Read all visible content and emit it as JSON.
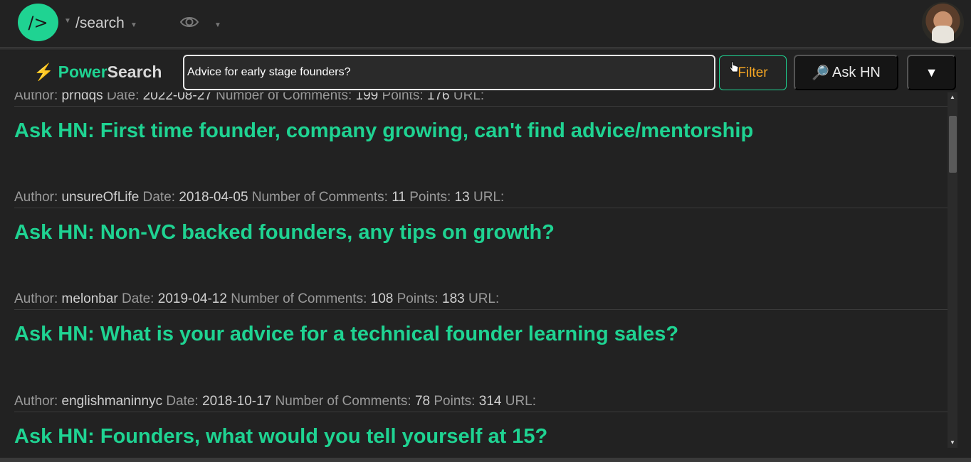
{
  "header": {
    "logo_text": "/>",
    "path": "/search",
    "visibility_icon": "eye-icon"
  },
  "search": {
    "brand_bolt": "⚡",
    "brand_power": "Power",
    "brand_search": "Search",
    "query": "Advice for early stage founders?",
    "filter_label": "Filter",
    "ask_label": "Ask HN",
    "ask_icon": "🔎",
    "dropdown_icon": "▼"
  },
  "labels": {
    "author": "Author:",
    "date": "Date:",
    "comments": "Number of Comments:",
    "points": "Points:",
    "url": "URL:"
  },
  "results": [
    {
      "author": "prndqs",
      "date": "2022-08-27",
      "comments": "199",
      "points": "176",
      "title": "Ask HN: First time founder, company growing, can't find advice/mentorship"
    },
    {
      "author": "unsureOfLife",
      "date": "2018-04-05",
      "comments": "11",
      "points": "13",
      "title": "Ask HN: Non-VC backed founders, any tips on growth?"
    },
    {
      "author": "melonbar",
      "date": "2019-04-12",
      "comments": "108",
      "points": "183",
      "title": "Ask HN: What is your advice for a technical founder learning sales?"
    },
    {
      "author": "englishmaninnyc",
      "date": "2018-10-17",
      "comments": "78",
      "points": "314",
      "title": "Ask HN: Founders, what would you tell yourself at 15?"
    }
  ],
  "colors": {
    "accent": "#1fd392",
    "background": "#222222",
    "filter_text": "#f5a623"
  }
}
